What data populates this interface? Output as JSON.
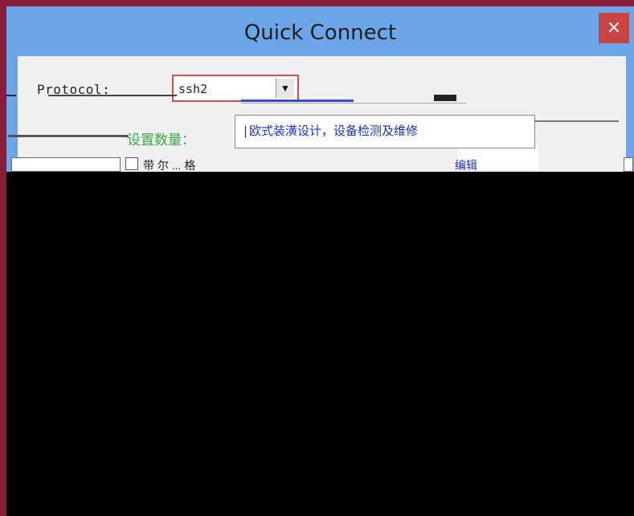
{
  "window": {
    "title": "Quick Connect",
    "close_label": "×"
  },
  "form": {
    "protocol_label": "Protocol:",
    "protocol_value": "ssh2",
    "protocol_arrow": "▼",
    "green_text": "设置数量：",
    "field_text": "|欧式装潢设计，设备检测及维修",
    "row_label": "带  尔 ...  格",
    "row_link": "编辑"
  },
  "colors": {
    "title_bar": "#6ca6e8",
    "close_button": "#c94545",
    "accent_border": "#d94a4a",
    "green_text": "#3aa84a",
    "blue_text": "#1b2fd1",
    "frame": "#8b1d3c"
  }
}
